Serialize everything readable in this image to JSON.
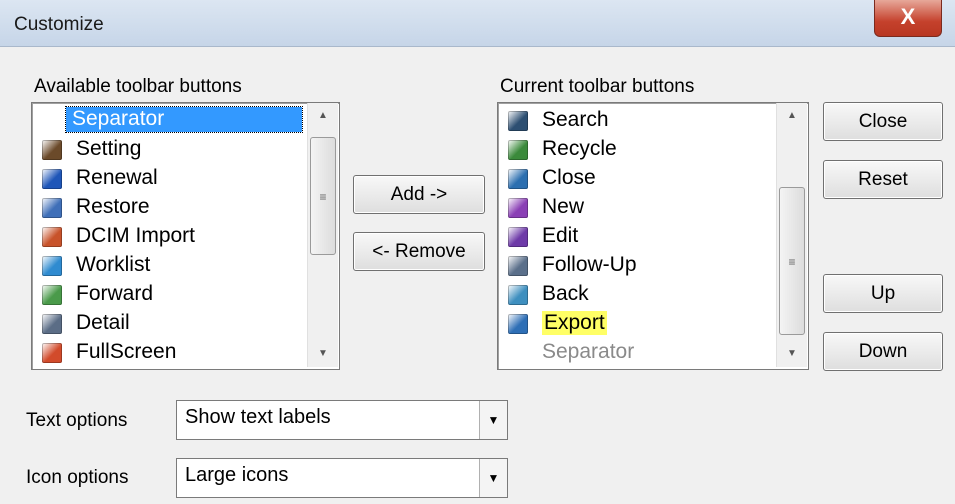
{
  "window": {
    "title": "Customize",
    "close_glyph": "X"
  },
  "available": {
    "label": "Available toolbar buttons",
    "items": [
      {
        "label": "Separator",
        "icon": "none",
        "selected": true
      },
      {
        "label": "Setting",
        "icon": "setting-icon",
        "color": "#6b4a2a"
      },
      {
        "label": "Renewal",
        "icon": "renewal-icon",
        "color": "#1f56b8"
      },
      {
        "label": "Restore",
        "icon": "restore-icon",
        "color": "#3f6fb8"
      },
      {
        "label": "DCIM Import",
        "icon": "dcim-import-icon",
        "color": "#c8532b"
      },
      {
        "label": "Worklist",
        "icon": "worklist-icon",
        "color": "#2f8bd0"
      },
      {
        "label": "Forward",
        "icon": "forward-icon",
        "color": "#4a9a4a"
      },
      {
        "label": "Detail",
        "icon": "detail-icon",
        "color": "#5b6d86"
      },
      {
        "label": "FullScreen",
        "icon": "fullscreen-icon",
        "color": "#d24b2b"
      }
    ]
  },
  "current": {
    "label": "Current toolbar buttons",
    "items": [
      {
        "label": "Search",
        "icon": "search-icon",
        "color": "#2d4f72"
      },
      {
        "label": "Recycle",
        "icon": "recycle-icon",
        "color": "#3b8a3b"
      },
      {
        "label": "Close",
        "icon": "close-icon",
        "color": "#2c6fb0"
      },
      {
        "label": "New",
        "icon": "new-icon",
        "color": "#8a3fb5"
      },
      {
        "label": "Edit",
        "icon": "edit-icon",
        "color": "#6e3aa8"
      },
      {
        "label": "Follow-Up",
        "icon": "follow-up-icon",
        "color": "#5a6f8a"
      },
      {
        "label": "Back",
        "icon": "back-icon",
        "color": "#3e8fbf"
      },
      {
        "label": "Export",
        "icon": "export-icon",
        "color": "#2e6fb6",
        "highlight": true
      },
      {
        "label": "Separator",
        "icon": "none",
        "dim": true
      }
    ]
  },
  "buttons": {
    "add": "Add ->",
    "remove": "<- Remove",
    "close": "Close",
    "reset": "Reset",
    "up": "Up",
    "down": "Down"
  },
  "text_options": {
    "label": "Text options",
    "value": "Show text labels"
  },
  "icon_options": {
    "label": "Icon options",
    "value": "Large icons"
  },
  "colors": {
    "selection": "#3399ff",
    "highlight": "#ffff66"
  }
}
